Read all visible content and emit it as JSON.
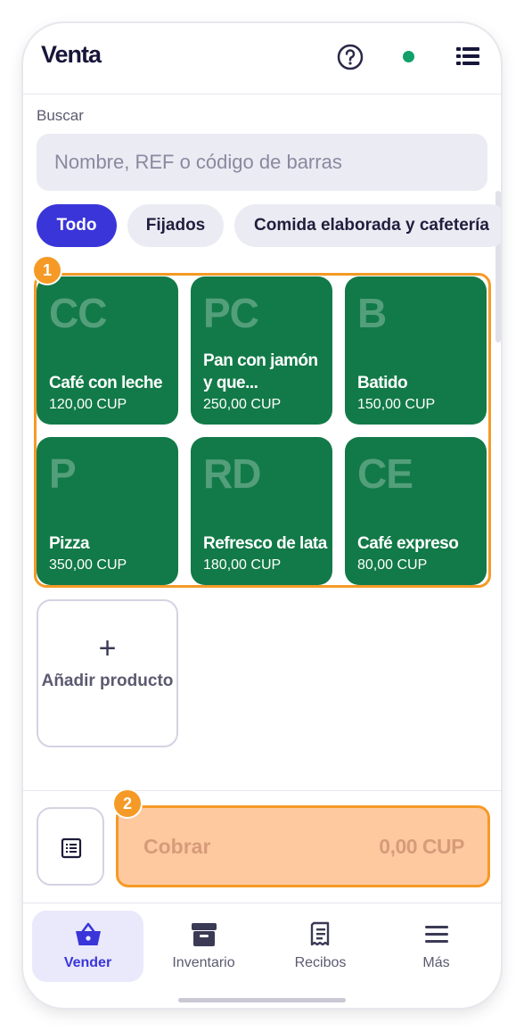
{
  "header": {
    "title": "Venta",
    "help_icon": "help-circle-icon",
    "status_color": "#11a06a",
    "menu_icon": "list-icon"
  },
  "search": {
    "label": "Buscar",
    "placeholder": "Nombre, REF o código de barras",
    "value": ""
  },
  "chips": [
    {
      "label": "Todo",
      "active": true
    },
    {
      "label": "Fijados",
      "active": false
    },
    {
      "label": "Comida elaborada y cafetería",
      "active": false
    }
  ],
  "annotations": {
    "grid_badge": "1",
    "charge_badge": "2",
    "highlight_color": "#f59a26"
  },
  "products": [
    {
      "abbr": "CC",
      "name": "Café con leche",
      "price": "120,00 CUP"
    },
    {
      "abbr": "PC",
      "name": "Pan con jamón y que...",
      "price": "250,00 CUP"
    },
    {
      "abbr": "B",
      "name": "Batido",
      "price": "150,00 CUP"
    },
    {
      "abbr": "P",
      "name": "Pizza",
      "price": "350,00 CUP"
    },
    {
      "abbr": "RD",
      "name": "Refresco de lata",
      "price": "180,00 CUP"
    },
    {
      "abbr": "CE",
      "name": "Café expreso",
      "price": "80,00 CUP"
    }
  ],
  "product_color": "#127a48",
  "add_product": {
    "icon": "plus-icon",
    "label": "Añadir producto"
  },
  "checkout": {
    "receipt_icon": "receipt-list-icon",
    "label": "Cobrar",
    "amount": "0,00 CUP"
  },
  "nav": [
    {
      "label": "Vender",
      "icon": "basket-icon",
      "active": true
    },
    {
      "label": "Inventario",
      "icon": "archive-box-icon",
      "active": false
    },
    {
      "label": "Recibos",
      "icon": "receipt-icon",
      "active": false
    },
    {
      "label": "Más",
      "icon": "menu-icon",
      "active": false
    }
  ]
}
